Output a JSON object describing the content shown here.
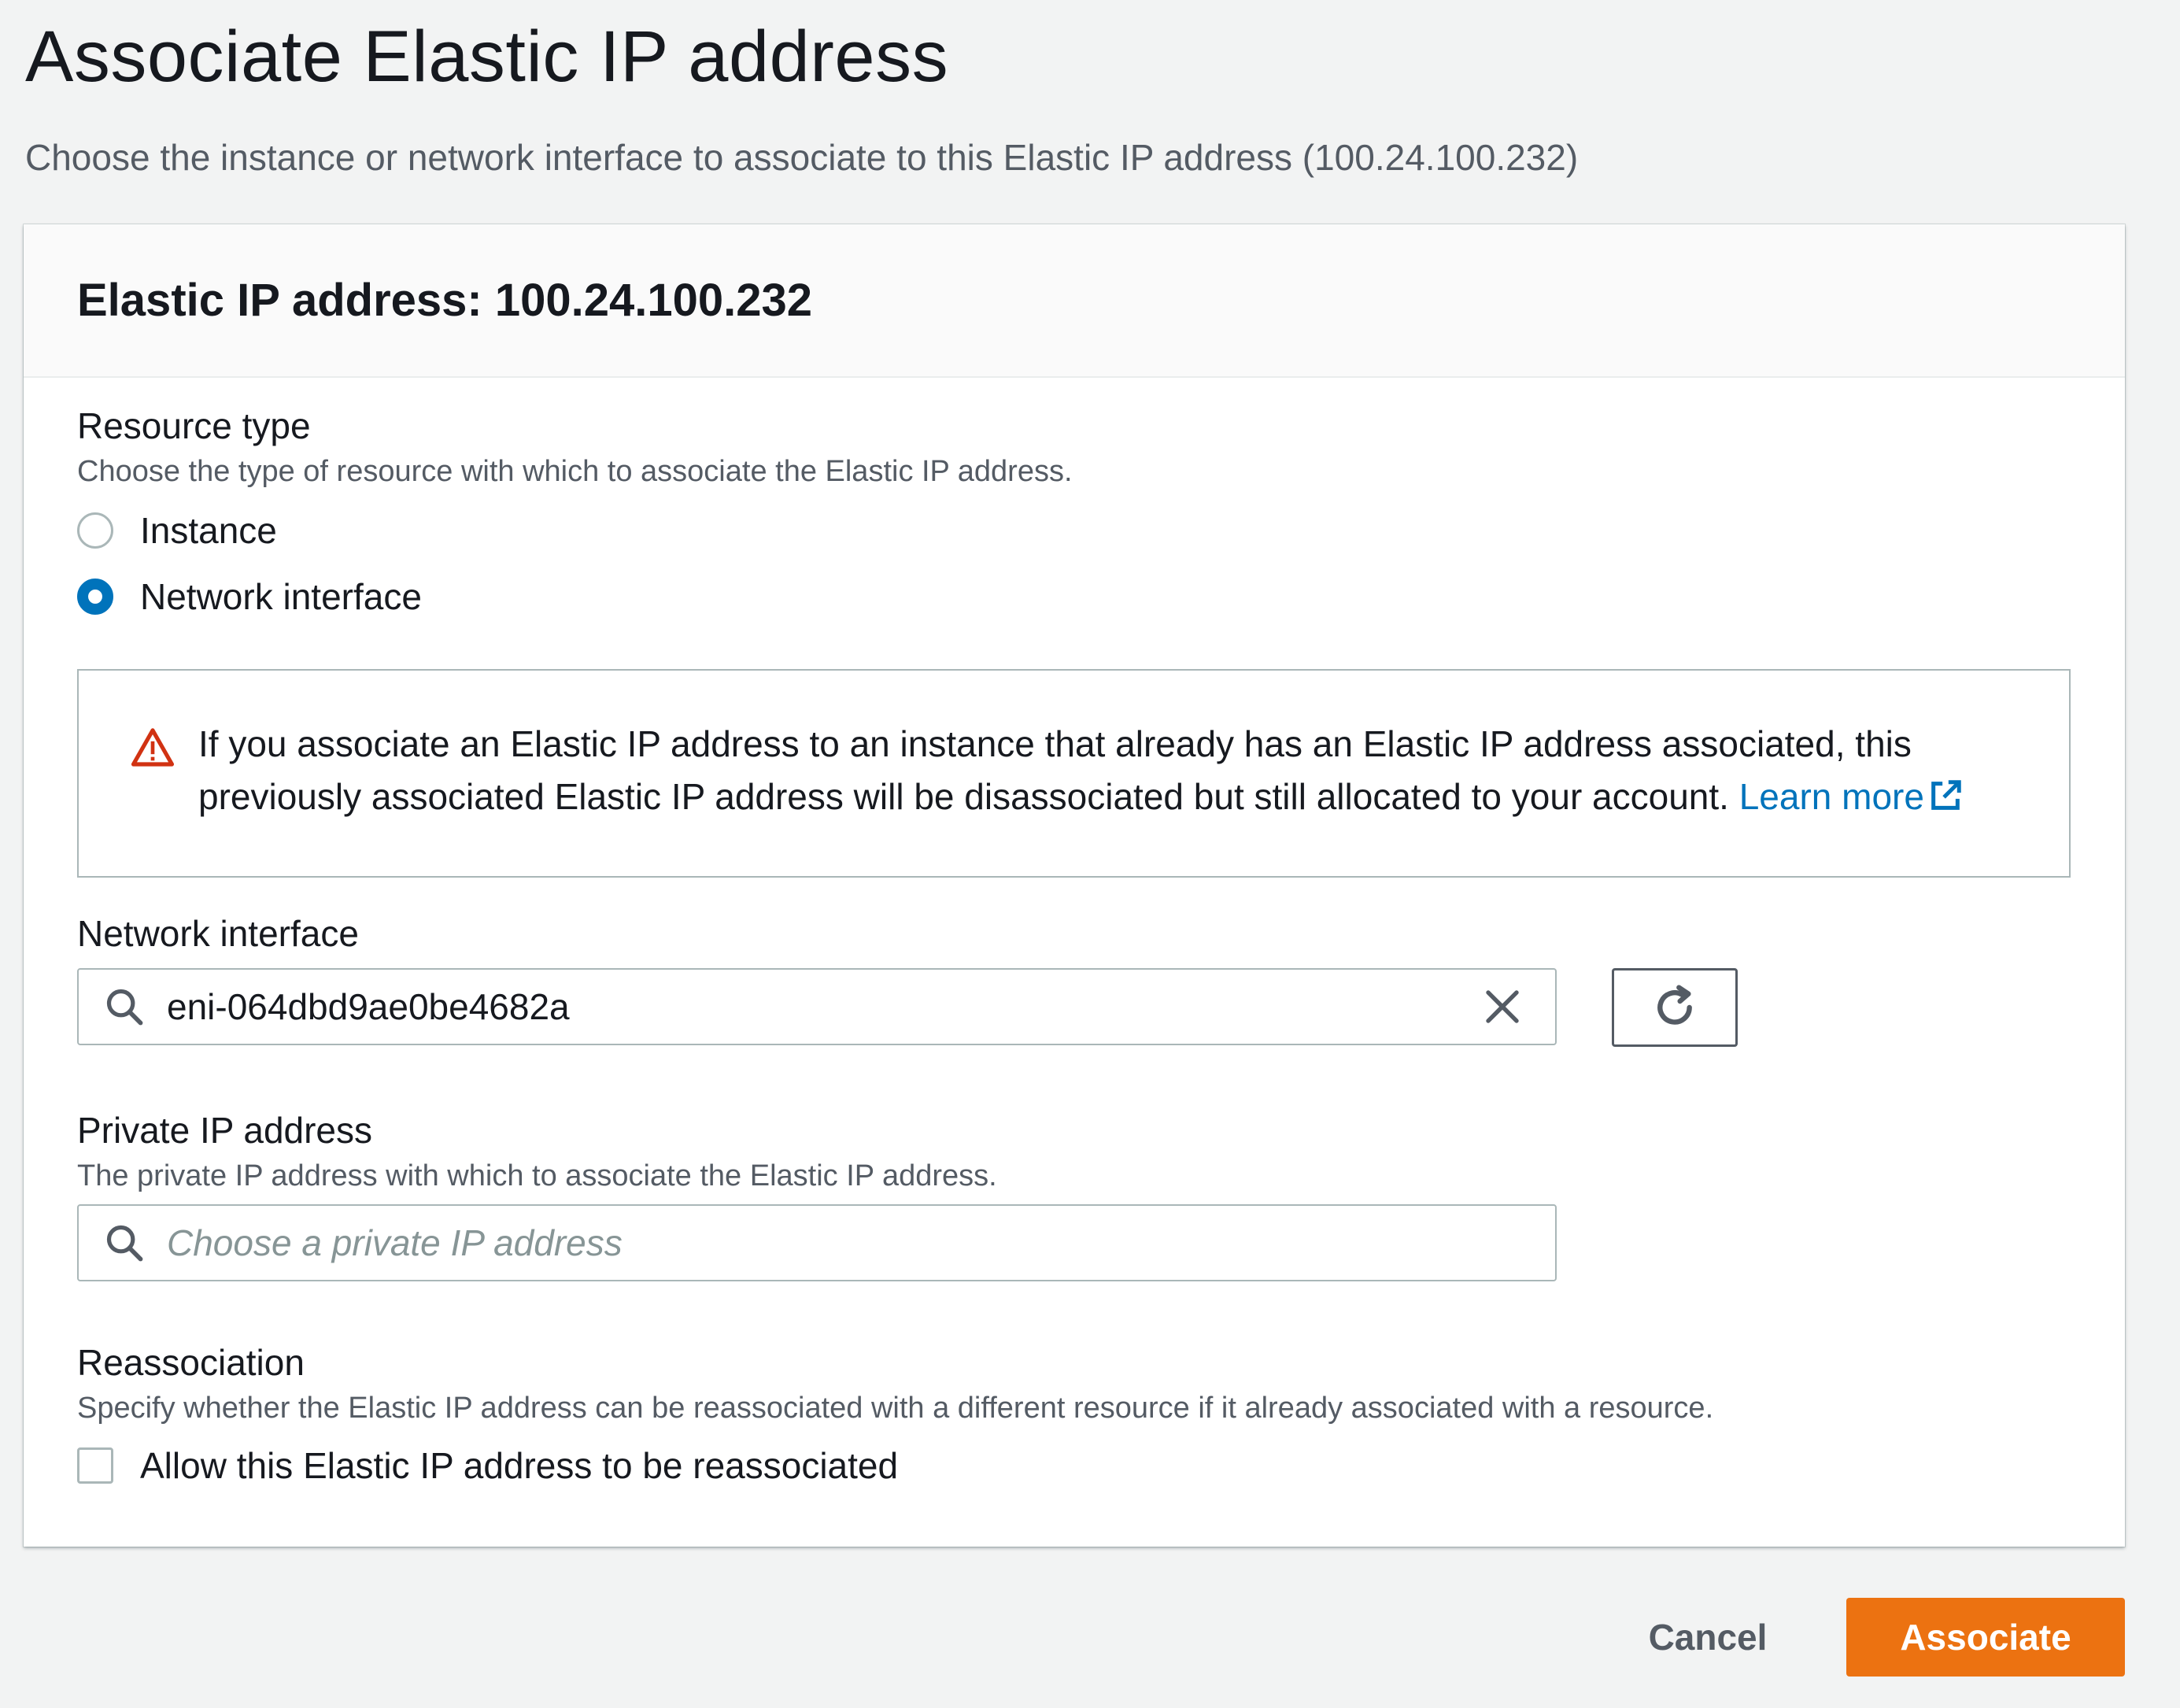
{
  "page": {
    "title": "Associate Elastic IP address",
    "subtitle": "Choose the instance or network interface to associate to this Elastic IP address (100.24.100.232)"
  },
  "panel": {
    "title": "Elastic IP address: 100.24.100.232"
  },
  "resource_type": {
    "label": "Resource type",
    "description": "Choose the type of resource with which to associate the Elastic IP address.",
    "options": [
      {
        "label": "Instance",
        "selected": false
      },
      {
        "label": "Network interface",
        "selected": true
      }
    ]
  },
  "alert": {
    "icon": "warning-triangle-icon",
    "text": "If you associate an Elastic IP address to an instance that already has an Elastic IP address associated, this previously associated Elastic IP address will be disassociated but still allocated to your account. ",
    "link_text": "Learn more"
  },
  "network_interface": {
    "label": "Network interface",
    "value": "eni-064dbd9ae0be4682a"
  },
  "private_ip": {
    "label": "Private IP address",
    "description": "The private IP address with which to associate the Elastic IP address.",
    "placeholder": "Choose a private IP address"
  },
  "reassociation": {
    "label": "Reassociation",
    "description": "Specify whether the Elastic IP address can be reassociated with a different resource if it already associated with a resource.",
    "checkbox_label": "Allow this Elastic IP address to be reassociated",
    "checked": false
  },
  "footer": {
    "cancel_label": "Cancel",
    "associate_label": "Associate"
  },
  "colors": {
    "primary": "#ec7211",
    "link": "#0073bb",
    "warning": "#d13212"
  }
}
